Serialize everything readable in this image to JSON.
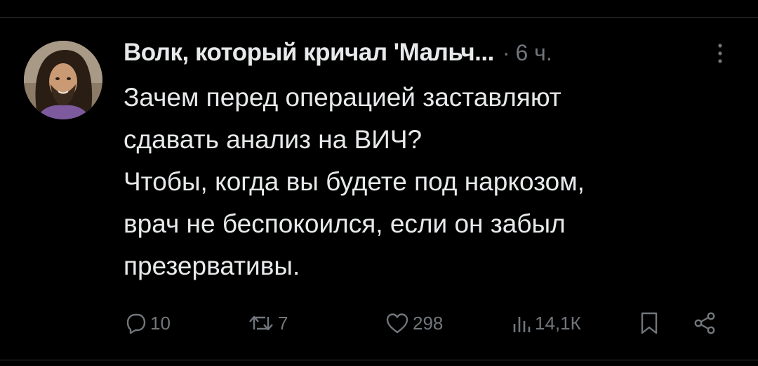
{
  "tweet": {
    "author_name": "Волк, который кричал 'Мальч...",
    "meta_dot": "·",
    "timestamp": "6 ч.",
    "text_lines": [
      "Зачем перед операцией заставляют",
      "сдавать анализ на ВИЧ?",
      "Чтобы, когда вы будете под наркозом,",
      "врач не беспокоился, если он забыл",
      "презервативы."
    ]
  },
  "actions": {
    "replies": "10",
    "retweets": "7",
    "likes": "298",
    "views": "14,1К"
  },
  "icons": {
    "avatar": "avatar-image",
    "more": "more-vertical-icon",
    "reply": "reply-icon",
    "retweet": "retweet-icon",
    "like": "heart-icon",
    "views": "views-chart-icon",
    "bookmark": "bookmark-icon",
    "share": "share-icon"
  },
  "colors": {
    "background": "#000000",
    "text": "#e7e9ea",
    "muted": "#71767b",
    "divider": "#2f3336"
  }
}
